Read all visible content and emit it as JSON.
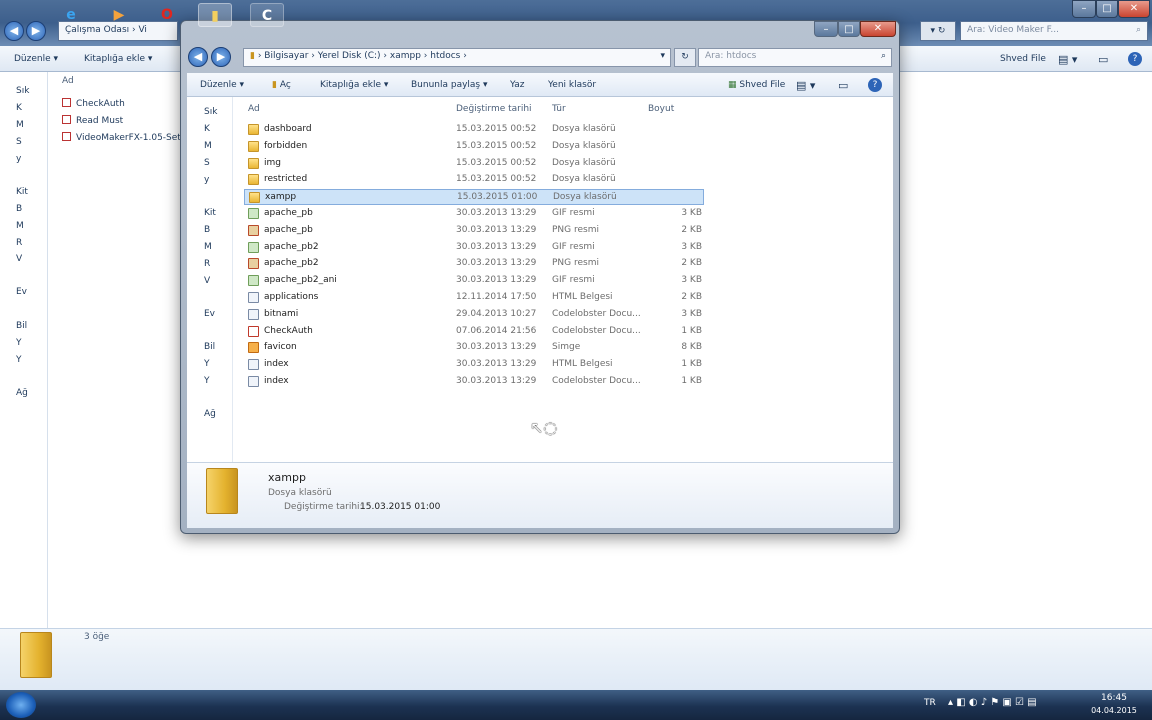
{
  "bg_window": {
    "address_text": "Çalışma Odası › Vi",
    "search_placeholder": "Ara: Video Maker F...",
    "toolbar": {
      "organize": "Düzenle ▾",
      "add_library": "Kitaplığa ekle ▾",
      "shared_file": "Shved File"
    },
    "column_name": "Ad",
    "nav_items": [
      "Sık",
      "K",
      "M",
      "S",
      "y",
      "Kit",
      "B",
      "M",
      "R",
      "V",
      "Ev",
      "Bil",
      "Y",
      "Y",
      "Ağ"
    ],
    "files": [
      "CheckAuth",
      "Read Must",
      "VideoMakerFX-1.05-Set"
    ],
    "status_count": "3 öğe"
  },
  "fg_window": {
    "breadcrumb": [
      "Bilgisayar",
      "Yerel Disk (C:)",
      "xampp",
      "htdocs"
    ],
    "search_placeholder": "Ara: htdocs",
    "toolbar": {
      "organize": "Düzenle ▾",
      "open": "Aç",
      "add_library": "Kitaplığa ekle ▾",
      "share": "Bununla paylaş ▾",
      "burn": "Yaz",
      "new_folder": "Yeni klasör",
      "shared_file": "Shved File"
    },
    "columns": {
      "name": "Ad",
      "date": "Değiştirme tarihi",
      "type": "Tür",
      "size": "Boyut"
    },
    "nav_items": [
      "Sık",
      "K",
      "M",
      "S",
      "y",
      "Kit",
      "B",
      "M",
      "R",
      "V",
      "Ev",
      "Bil",
      "Y",
      "Y",
      "Ağ"
    ],
    "files": [
      {
        "name": "dashboard",
        "date": "15.03.2015 00:52",
        "type": "Dosya klasörü",
        "size": "",
        "icon": "folder"
      },
      {
        "name": "forbidden",
        "date": "15.03.2015 00:52",
        "type": "Dosya klasörü",
        "size": "",
        "icon": "folder"
      },
      {
        "name": "img",
        "date": "15.03.2015 00:52",
        "type": "Dosya klasörü",
        "size": "",
        "icon": "folder"
      },
      {
        "name": "restricted",
        "date": "15.03.2015 00:52",
        "type": "Dosya klasörü",
        "size": "",
        "icon": "folder"
      },
      {
        "name": "xampp",
        "date": "15.03.2015 01:00",
        "type": "Dosya klasörü",
        "size": "",
        "icon": "folder"
      },
      {
        "name": "apache_pb",
        "date": "30.03.2013 13:29",
        "type": "GIF resmi",
        "size": "3 KB",
        "icon": "gif"
      },
      {
        "name": "apache_pb",
        "date": "30.03.2013 13:29",
        "type": "PNG resmi",
        "size": "2 KB",
        "icon": "png"
      },
      {
        "name": "apache_pb2",
        "date": "30.03.2013 13:29",
        "type": "GIF resmi",
        "size": "3 KB",
        "icon": "gif"
      },
      {
        "name": "apache_pb2",
        "date": "30.03.2013 13:29",
        "type": "PNG resmi",
        "size": "2 KB",
        "icon": "png"
      },
      {
        "name": "apache_pb2_ani",
        "date": "30.03.2013 13:29",
        "type": "GIF resmi",
        "size": "3 KB",
        "icon": "gif"
      },
      {
        "name": "applications",
        "date": "12.11.2014 17:50",
        "type": "HTML Belgesi",
        "size": "2 KB",
        "icon": "html"
      },
      {
        "name": "bitnami",
        "date": "29.04.2013 10:27",
        "type": "Codelobster Docu...",
        "size": "3 KB",
        "icon": "html"
      },
      {
        "name": "CheckAuth",
        "date": "07.06.2014 21:56",
        "type": "Codelobster Docu...",
        "size": "1 KB",
        "icon": "cl"
      },
      {
        "name": "favicon",
        "date": "30.03.2013 13:29",
        "type": "Simge",
        "size": "8 KB",
        "icon": "sim"
      },
      {
        "name": "index",
        "date": "30.03.2013 13:29",
        "type": "HTML Belgesi",
        "size": "1 KB",
        "icon": "html"
      },
      {
        "name": "index",
        "date": "30.03.2013 13:29",
        "type": "Codelobster Docu...",
        "size": "1 KB",
        "icon": "html"
      }
    ],
    "selected_index": 4,
    "details": {
      "name": "xampp",
      "type": "Dosya klasörü",
      "date_label": "Değiştirme tarihi:",
      "date_value": "15.03.2015 01:00"
    }
  },
  "taskbar": {
    "lang": "TR",
    "time": "16:45",
    "date": "04.04.2015"
  }
}
